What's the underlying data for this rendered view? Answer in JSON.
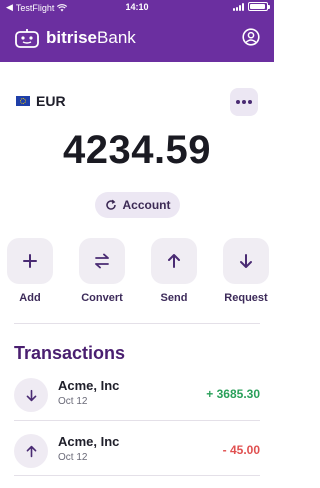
{
  "status_bar": {
    "carrier": "TestFlight",
    "time": "14:10"
  },
  "app": {
    "brand_prefix": "bitrise",
    "brand_suffix": "Bank"
  },
  "wallet": {
    "currency": "EUR",
    "balance": "4234.59",
    "account_label": "Account"
  },
  "actions": [
    {
      "label": "Add",
      "icon": "plus-icon"
    },
    {
      "label": "Convert",
      "icon": "swap-icon"
    },
    {
      "label": "Send",
      "icon": "arrow-up-icon"
    },
    {
      "label": "Request",
      "icon": "arrow-down-icon"
    }
  ],
  "transactions": {
    "title": "Transactions",
    "items": [
      {
        "name": "Acme, Inc",
        "date": "Oct 12",
        "amount": "+ 3685.30",
        "direction": "in"
      },
      {
        "name": "Acme, Inc",
        "date": "Oct 12",
        "amount": "- 45.00",
        "direction": "out"
      }
    ]
  },
  "colors": {
    "brand": "#6b2fa0",
    "accent": "#4a1f70",
    "positive": "#2aa05a",
    "negative": "#e05050"
  }
}
